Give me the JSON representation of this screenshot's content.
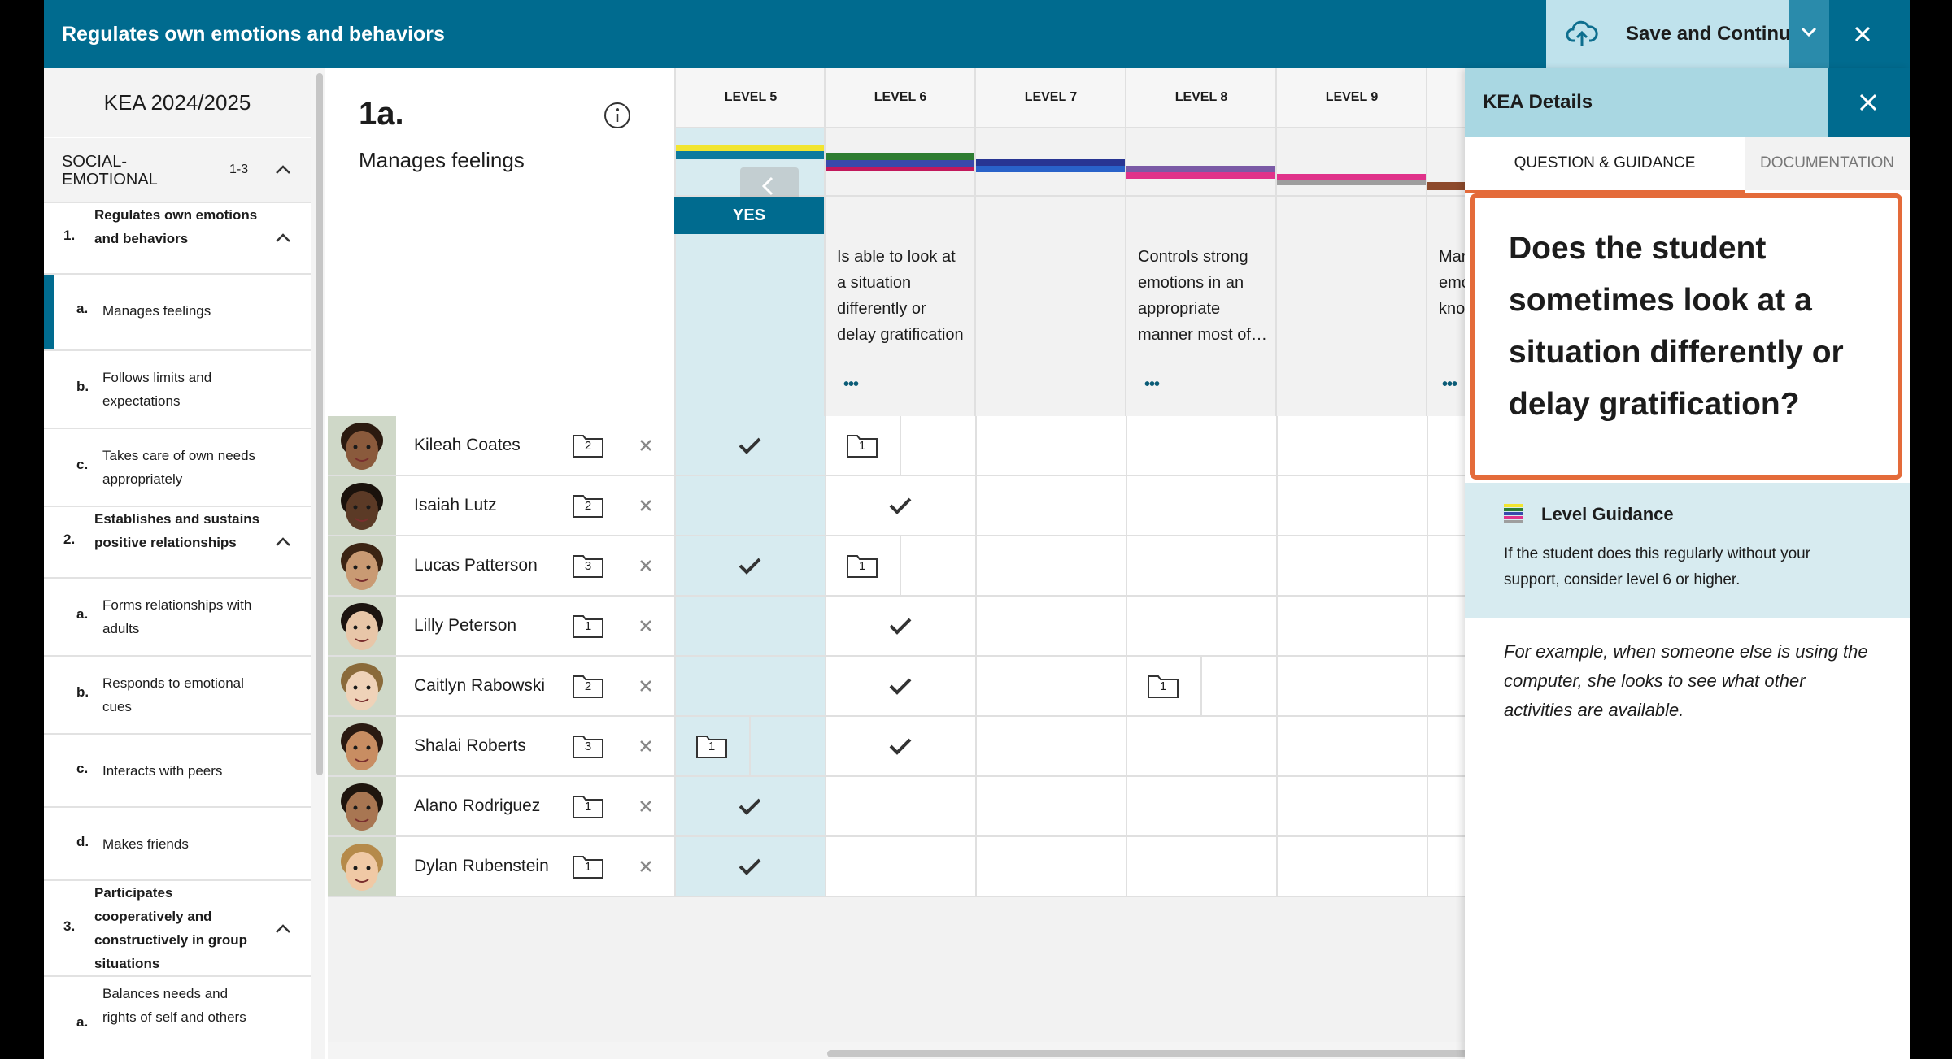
{
  "window": {
    "title": "Regulates own emotions and behaviors",
    "save_label": "Save and Continue"
  },
  "sidebar": {
    "year": "KEA 2024/2025",
    "domain": {
      "name": "SOCIAL-EMOTIONAL",
      "range": "1-3"
    },
    "items": [
      {
        "num": "1.",
        "label": "Regulates own emotions and behaviors"
      },
      {
        "num": "a.",
        "label": "Manages feelings"
      },
      {
        "num": "b.",
        "label": "Follows limits and expectations"
      },
      {
        "num": "c.",
        "label": "Takes care of own needs appropriately"
      },
      {
        "num": "2.",
        "label": "Establishes and sustains positive relationships"
      },
      {
        "num": "a.",
        "label": "Forms relationships with adults"
      },
      {
        "num": "b.",
        "label": "Responds to emotional cues"
      },
      {
        "num": "c.",
        "label": "Interacts with peers"
      },
      {
        "num": "d.",
        "label": "Makes friends"
      },
      {
        "num": "3.",
        "label": "Participates cooperatively and constructively in group situations"
      },
      {
        "num": "a.",
        "label": "Balances needs and rights of self and others"
      }
    ]
  },
  "skill": {
    "number": "1a.",
    "name": "Manages feelings"
  },
  "levels": [
    {
      "label": "LEVEL 5",
      "desc": "",
      "colors": [
        "#f2e530",
        "#0d7a9e"
      ],
      "selected": true
    },
    {
      "label": "LEVEL 6",
      "desc": "Is able to look at a situation differently or delay gratification",
      "colors": [
        "#2e7d32",
        "#3949ab",
        "#c2185b"
      ],
      "selected": false
    },
    {
      "label": "LEVEL 7",
      "desc": "",
      "colors": [
        "#283593",
        "#2962c9"
      ],
      "selected": false
    },
    {
      "label": "LEVEL 8",
      "desc": "Controls strong emotions in an appropriate manner most of…",
      "colors": [
        "#7b5aa6",
        "#e0328a"
      ],
      "selected": false
    },
    {
      "label": "LEVEL 9",
      "desc": "",
      "colors": [
        "#e0328a",
        "#9e9e9e"
      ],
      "selected": false
    }
  ],
  "yes_label": "YES",
  "more_label": "•••",
  "peek_desc": "Mar emo kno",
  "students": [
    {
      "name": "Kileah Coates",
      "docs": "2",
      "marks": [
        "check",
        "folder-1",
        "",
        "",
        ""
      ]
    },
    {
      "name": "Isaiah Lutz",
      "docs": "2",
      "marks": [
        "",
        "check",
        "",
        "",
        ""
      ]
    },
    {
      "name": "Lucas Patterson",
      "docs": "3",
      "marks": [
        "check",
        "folder-1",
        "",
        "",
        ""
      ]
    },
    {
      "name": "Lilly Peterson",
      "docs": "1",
      "marks": [
        "",
        "check",
        "",
        "",
        ""
      ]
    },
    {
      "name": "Caitlyn Rabowski",
      "docs": "2",
      "marks": [
        "",
        "check",
        "",
        "folder-1",
        ""
      ]
    },
    {
      "name": "Shalai Roberts",
      "docs": "3",
      "marks": [
        "folder-1",
        "check",
        "",
        "",
        ""
      ]
    },
    {
      "name": "Alano Rodriguez",
      "docs": "1",
      "marks": [
        "check",
        "",
        "",
        "",
        ""
      ]
    },
    {
      "name": "Dylan Rubenstein",
      "docs": "1",
      "marks": [
        "check",
        "",
        "",
        "",
        ""
      ]
    }
  ],
  "folder_count": "1",
  "details": {
    "title": "KEA Details",
    "tab_question": "QUESTION & GUIDANCE",
    "tab_documentation": "DOCUMENTATION",
    "question": "Does the student sometimes look at a situation differently or delay gratification?",
    "guidance_title": "Level Guidance",
    "guidance_text": "If the student does this regularly without your support, consider level 6 or higher.",
    "example": "For example, when someone else is using the computer, she looks to see what other activities are available."
  },
  "colors": {
    "primary": "#006b8f",
    "accent": "#e46b3a",
    "selected_column": "#d7ebf0"
  }
}
